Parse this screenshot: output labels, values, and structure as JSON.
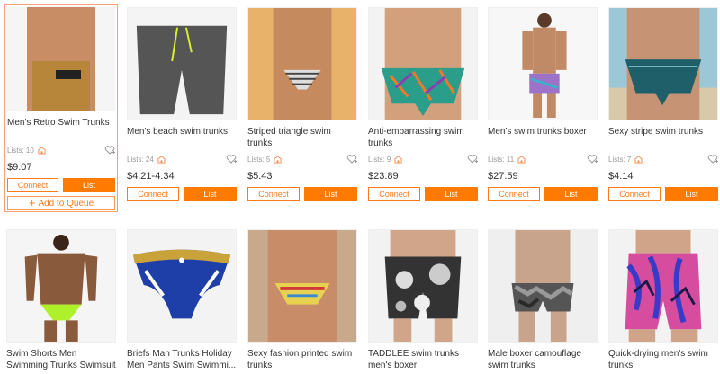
{
  "products": [
    {
      "title": "Men's Retro Swim Trunks",
      "lists": "Lists: 10",
      "price": "$9.07",
      "connect": "Connect",
      "list": "List",
      "queue": "Add to Queue",
      "skin": "#c98d66",
      "suit": "#b8863a",
      "bg": "#f5f5f5"
    },
    {
      "title": "Men's beach swim trunks",
      "lists": "Lists: 24",
      "price": "$4.21-4.34",
      "connect": "Connect",
      "list": "List",
      "skin": "#caa080",
      "suit": "#555555",
      "bg": "#f4f4f4"
    },
    {
      "title": "Striped triangle swim trunks",
      "lists": "Lists: 5",
      "price": "$5.43",
      "connect": "Connect",
      "list": "List",
      "skin": "#c68a5f",
      "suit": "#dddddd",
      "bg": "#e9b26a"
    },
    {
      "title": "Anti-embarrassing swim trunks",
      "lists": "Lists: 9",
      "price": "$23.89",
      "connect": "Connect",
      "list": "List",
      "skin": "#d2a07c",
      "suit": "#2a9e8a",
      "bg": "#f3f3f3"
    },
    {
      "title": "Men's swim trunks boxer",
      "lists": "Lists: 11",
      "price": "$27.59",
      "connect": "Connect",
      "list": "List",
      "skin": "#c08a66",
      "suit": "#9d72c9",
      "bg": "#f7f7f7"
    },
    {
      "title": "Sexy stripe swim trunks",
      "lists": "Lists: 7",
      "price": "$4.14",
      "connect": "Connect",
      "list": "List",
      "skin": "#c69474",
      "suit": "#1f5f6a",
      "bg": "#9cc7d6"
    },
    {
      "title": "Swim Shorts Men Swimming Trunks Swimsuit Pants...",
      "skin": "#8a5a3c",
      "suit": "#aef02a",
      "bg": "#f5f5f5"
    },
    {
      "title": "Briefs Man Trunks Holiday Men Pants Swim Swimmi...",
      "skin": "#ffffff",
      "suit": "#1f3fa8",
      "bg": "#f3f3f3"
    },
    {
      "title": "Sexy fashion printed swim trunks",
      "skin": "#c88d68",
      "suit": "#e8d050",
      "bg": "#c9a98c"
    },
    {
      "title": "TADDLEE swim trunks men's boxer",
      "skin": "#d0a589",
      "suit": "#333333",
      "bg": "#f2f2f2"
    },
    {
      "title": "Male boxer camouflage swim trunks",
      "skin": "#c9a48c",
      "suit": "#555555",
      "bg": "#efefef"
    },
    {
      "title": "Quick-drying men's swim trunks",
      "skin": "#d0a488",
      "suit": "#d64c9e",
      "bg": "#f2f2f2"
    }
  ]
}
